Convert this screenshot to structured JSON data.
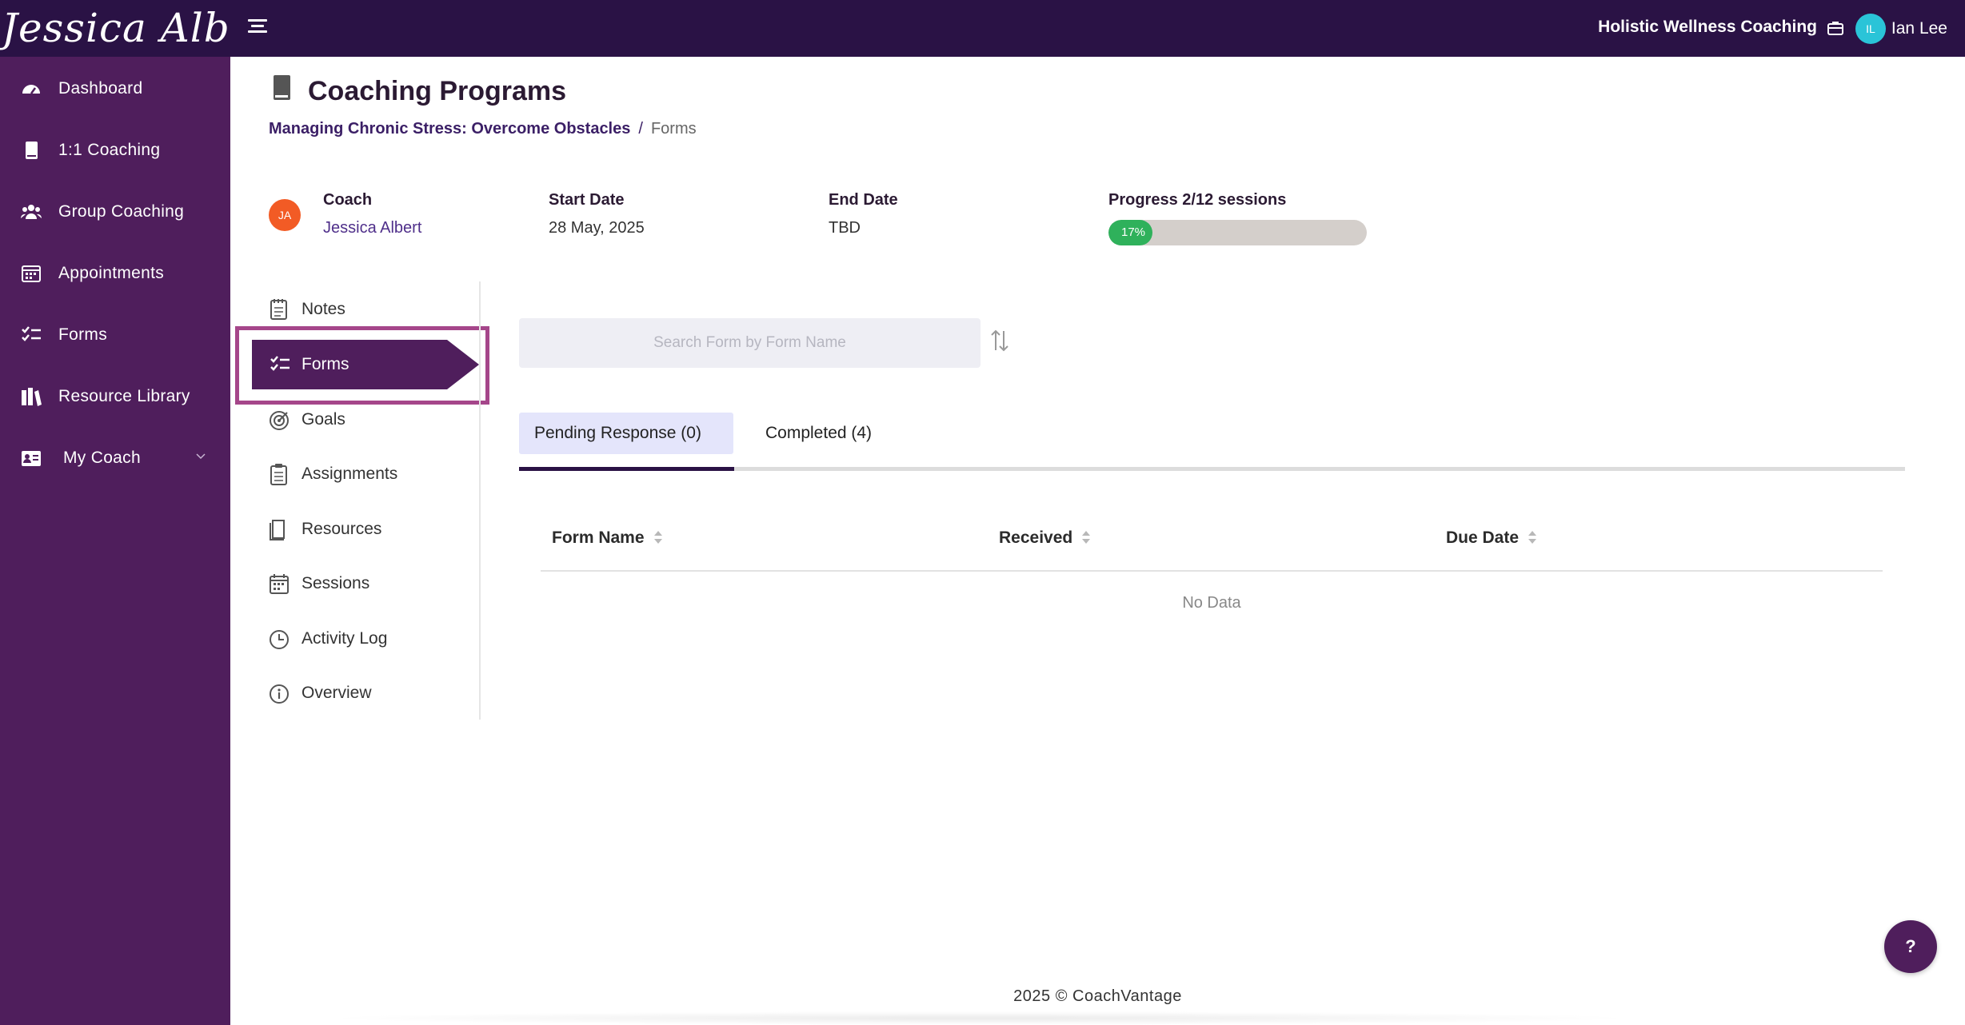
{
  "header": {
    "logo_text": "Jessica Albert",
    "org_name": "Holistic Wellness Coaching",
    "user_initials": "IL",
    "user_name": "Ian Lee"
  },
  "sidebar": {
    "items": [
      {
        "label": "Dashboard",
        "icon": "dashboard-icon"
      },
      {
        "label": "1:1 Coaching",
        "icon": "book-icon"
      },
      {
        "label": "Group Coaching",
        "icon": "group-icon"
      },
      {
        "label": "Appointments",
        "icon": "calendar-icon"
      },
      {
        "label": "Forms",
        "icon": "checklist-icon"
      },
      {
        "label": "Resource Library",
        "icon": "library-icon"
      },
      {
        "label": "My Coach",
        "icon": "coach-card-icon"
      }
    ]
  },
  "page": {
    "title": "Coaching Programs",
    "breadcrumb": {
      "program": "Managing Chronic Stress: Overcome Obstacles",
      "separator": "/",
      "current": "Forms"
    }
  },
  "program_info": {
    "coach_label": "Coach",
    "coach_initials": "JA",
    "coach_name": "Jessica Albert",
    "start_label": "Start Date",
    "start_value": "28 May, 2025",
    "end_label": "End Date",
    "end_value": "TBD",
    "progress_label": "Progress 2/12 sessions",
    "progress_text": "17%",
    "progress_percent": 17
  },
  "subnav": {
    "items": [
      {
        "label": "Notes",
        "icon": "notes-icon"
      },
      {
        "label": "Forms",
        "icon": "checklist-icon",
        "active": true
      },
      {
        "label": "Goals",
        "icon": "target-icon"
      },
      {
        "label": "Assignments",
        "icon": "clipboard-icon"
      },
      {
        "label": "Resources",
        "icon": "resources-icon"
      },
      {
        "label": "Sessions",
        "icon": "calendar-icon"
      },
      {
        "label": "Activity Log",
        "icon": "clock-icon"
      },
      {
        "label": "Overview",
        "icon": "info-icon"
      }
    ]
  },
  "forms": {
    "search_placeholder": "Search Form by Form Name",
    "tabs": [
      {
        "label": "Pending Response (0)",
        "active": true
      },
      {
        "label": "Completed (4)",
        "active": false
      }
    ],
    "columns": [
      "Form Name",
      "Received",
      "Due Date"
    ],
    "empty_text": "No Data"
  },
  "help_label": "?",
  "footer": "2025 © CoachVantage",
  "colors": {
    "topbar": "#2a1245",
    "sidebar": "#4f1e5c",
    "accent": "#4f2f8a",
    "progress": "#2fb15b",
    "highlight": "#a5468a"
  }
}
